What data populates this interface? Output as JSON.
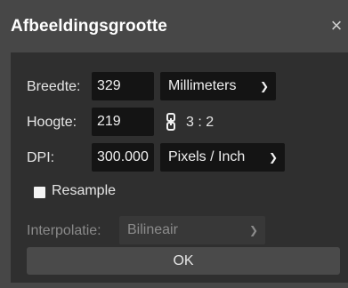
{
  "dialog": {
    "title": "Afbeeldingsgrootte",
    "close_symbol": "×"
  },
  "fields": {
    "width_label": "Breedte:",
    "width_value": "329",
    "unit_option": "Millimeters",
    "height_label": "Hoogte:",
    "height_value": "219",
    "ratio": "3 : 2",
    "dpi_label": "DPI:",
    "dpi_value": "300.000",
    "dpi_unit_option": "Pixels / Inch",
    "resample_label": "Resample",
    "resample_checked": false,
    "interpolation_label": "Interpolatie:",
    "interpolation_option": "Bilineair"
  },
  "buttons": {
    "ok_label": "OK"
  },
  "icons": {
    "chevron": "chevron-down-icon",
    "link": "link-icon",
    "close": "close-icon"
  }
}
